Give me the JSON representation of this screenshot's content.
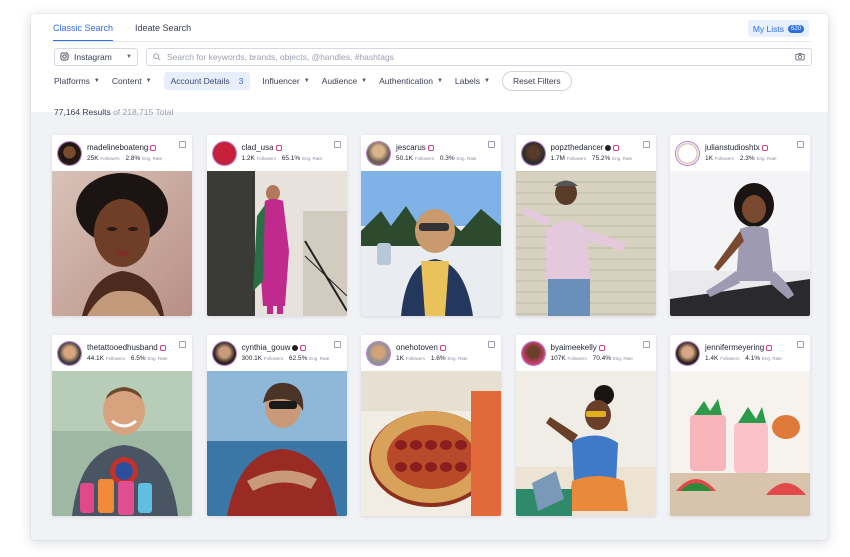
{
  "tabs": [
    {
      "label": "Classic Search",
      "active": true
    },
    {
      "label": "Ideate Search",
      "active": false
    }
  ],
  "my_lists": {
    "label": "My Lists",
    "count": "620"
  },
  "platform": {
    "selected": "Instagram",
    "icon": "instagram-icon"
  },
  "search": {
    "placeholder": "Search for keywords, brands, objects, @handles, #hashtags",
    "icon": "camera-icon"
  },
  "filters": [
    {
      "label": "Platforms"
    },
    {
      "label": "Content"
    },
    {
      "label": "Account Details",
      "count": "3",
      "selected": true
    },
    {
      "label": "Influencer"
    },
    {
      "label": "Audience"
    },
    {
      "label": "Authentication"
    },
    {
      "label": "Labels"
    }
  ],
  "reset_label": "Reset Filters",
  "results": {
    "count": "77,164 Results",
    "total": " of 218,715 Total"
  },
  "stat_labels": {
    "followers": "Followers",
    "eng_rate": "Eng. Rate"
  },
  "colors": {
    "accent": "#2f6fe0",
    "instagram_ring": "#b67bd0"
  },
  "cards": [
    {
      "handle": "madelineboateng",
      "verified": false,
      "followers": "25K",
      "eng_rate": "2.8%"
    },
    {
      "handle": "clad_usa",
      "verified": false,
      "followers": "1.2K",
      "eng_rate": "65.1%",
      "avatar_text": "CLAD"
    },
    {
      "handle": "jescarus",
      "verified": false,
      "followers": "50.1K",
      "eng_rate": "0.3%"
    },
    {
      "handle": "popzthedancer",
      "verified": true,
      "followers": "1.7M",
      "eng_rate": "75.2%"
    },
    {
      "handle": "julianstudioshtx",
      "verified": false,
      "followers": "1K",
      "eng_rate": "2.3%"
    },
    {
      "handle": "thetattooedhusband",
      "verified": false,
      "followers": "44.1K",
      "eng_rate": "6.5%"
    },
    {
      "handle": "cynthia_gouw",
      "verified": true,
      "followers": "300.1K",
      "eng_rate": "62.5%"
    },
    {
      "handle": "onehotoven",
      "verified": false,
      "followers": "1K",
      "eng_rate": "1.6%"
    },
    {
      "handle": "byaimeekelly",
      "verified": false,
      "followers": "107K",
      "eng_rate": "70.4%"
    },
    {
      "handle": "jennifermeyering",
      "verified": false,
      "followers": "1.4K",
      "eng_rate": "4.1%"
    }
  ]
}
